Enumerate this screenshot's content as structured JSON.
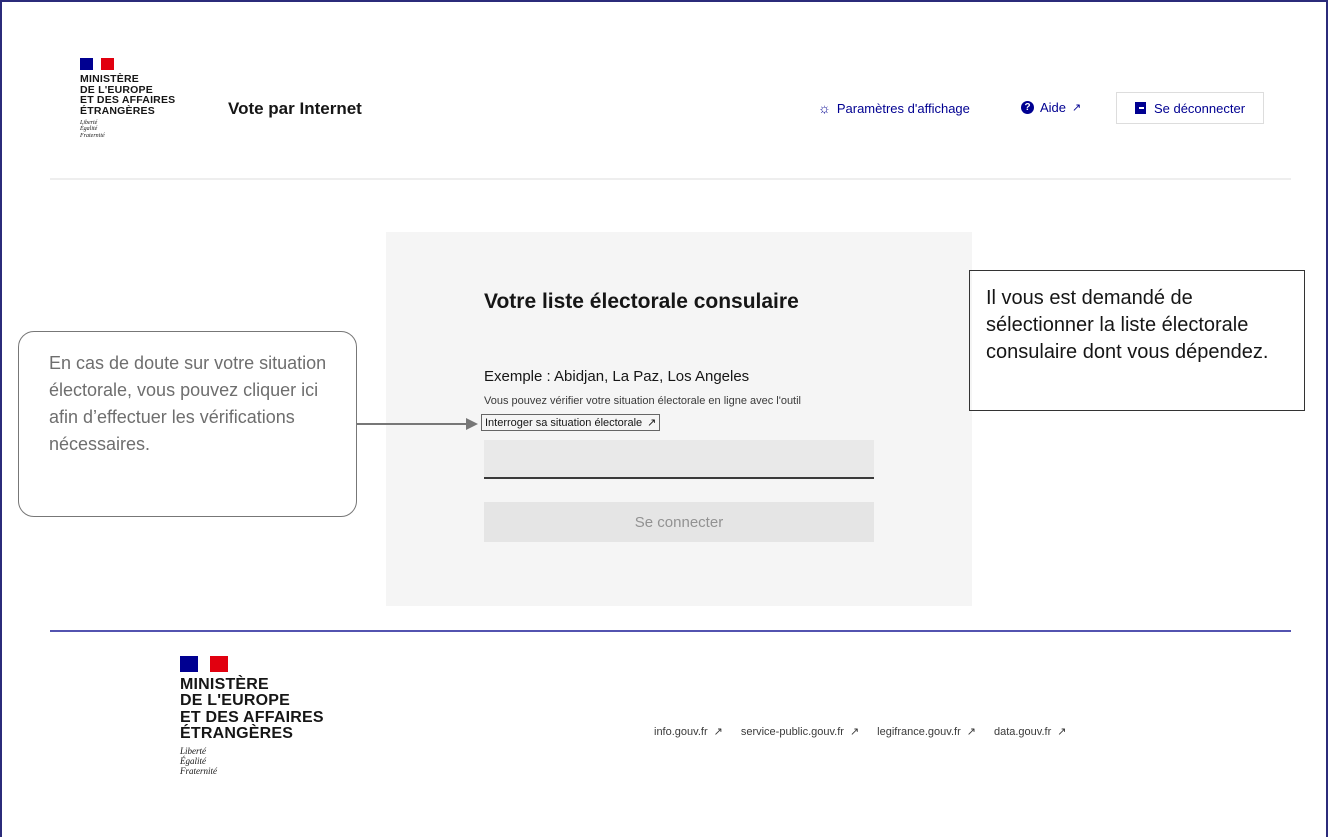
{
  "ministry": {
    "line1": "MINISTÈRE",
    "line2": "DE L'EUROPE",
    "line3": "ET DES AFFAIRES",
    "line4": "ÉTRANGÈRES",
    "motto1": "Liberté",
    "motto2": "Égalité",
    "motto3": "Fraternité"
  },
  "header": {
    "site_title": "Vote par Internet",
    "display_settings": "Paramètres d'affichage",
    "help": "Aide",
    "logout": "Se déconnecter",
    "icons": {
      "display": "sun-icon",
      "help": "help-icon",
      "external": "external-link-icon",
      "logout": "logout-icon"
    }
  },
  "form": {
    "title": "Votre liste électorale consulaire",
    "example": "Exemple : Abidjan, La Paz, Los Angeles",
    "hint": "Vous pouvez vérifier votre situation électorale en ligne avec l'outil",
    "check_link": "Interroger sa situation électorale",
    "input_value": "",
    "input_placeholder": "",
    "connect_button": "Se connecter"
  },
  "annotations": {
    "left_callout": "En cas de doute sur votre situation électorale, vous pouvez cliquer ici afin d’effectuer les vérifications nécessaires.",
    "right_callout": "Il vous est demandé de sélectionner la liste électorale consulaire dont vous dépendez."
  },
  "footer": {
    "links": [
      {
        "label": "info.gouv.fr"
      },
      {
        "label": "service-public.gouv.fr"
      },
      {
        "label": "legifrance.gouv.fr"
      },
      {
        "label": "data.gouv.fr"
      }
    ]
  },
  "colors": {
    "primary_blue": "#000091",
    "flag_red": "#e1000f",
    "card_background": "#f5f5f5"
  }
}
